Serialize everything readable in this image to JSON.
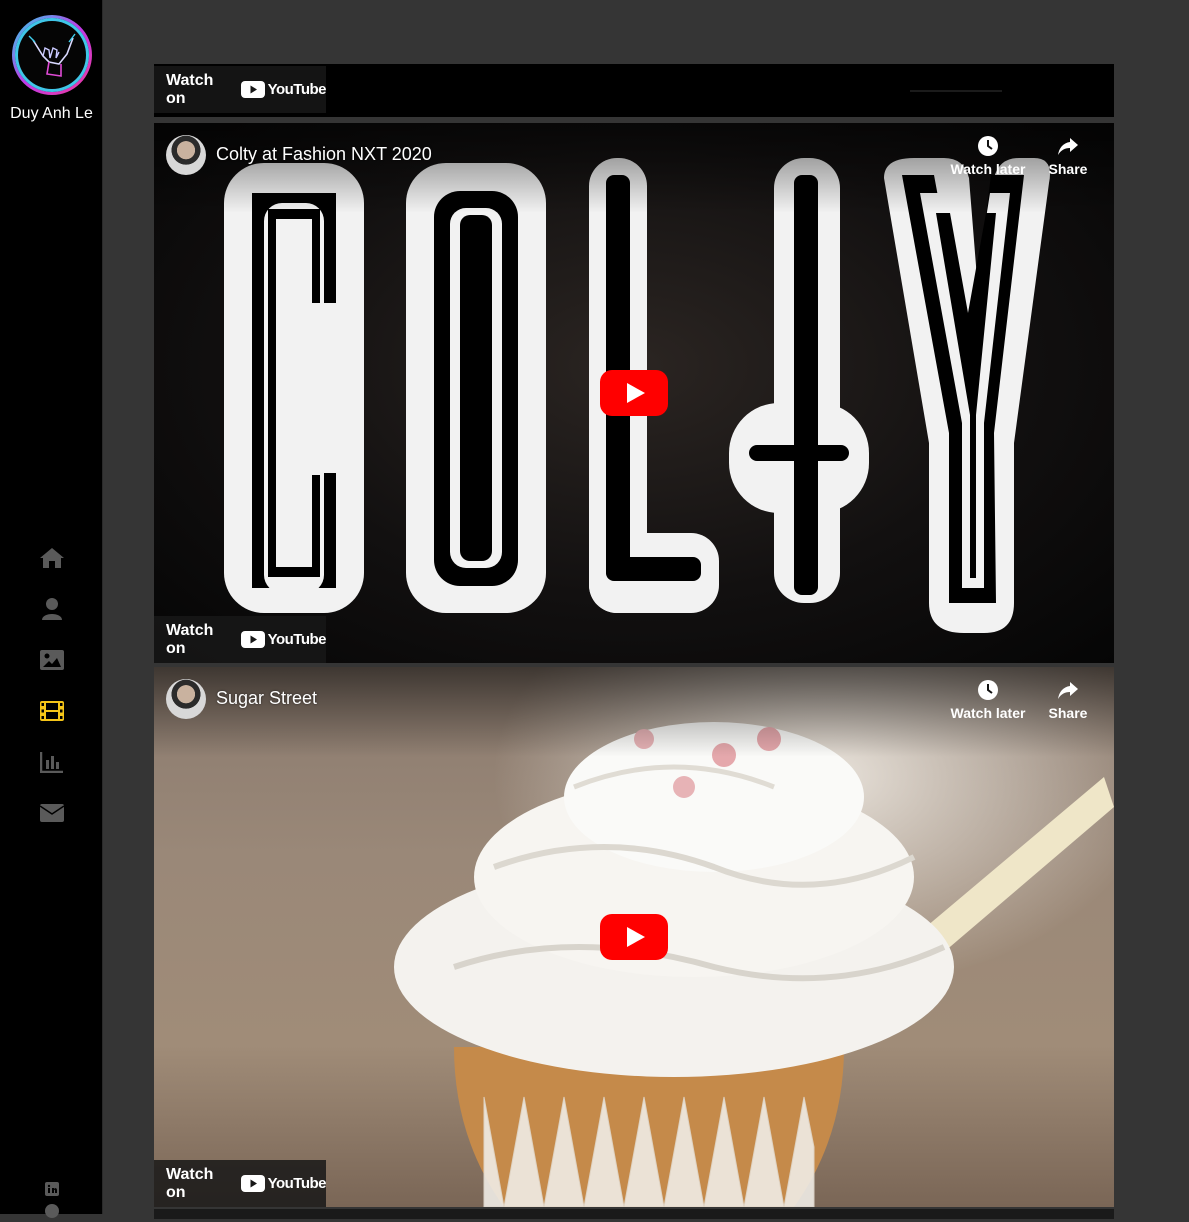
{
  "sidebar": {
    "site_name": "Duy Anh Le",
    "nav": [
      {
        "icon": "home-icon",
        "active": false
      },
      {
        "icon": "user-icon",
        "active": false
      },
      {
        "icon": "image-icon",
        "active": false
      },
      {
        "icon": "film-icon",
        "active": true
      },
      {
        "icon": "chart-icon",
        "active": false
      },
      {
        "icon": "envelope-icon",
        "active": false
      }
    ],
    "social": [
      {
        "icon": "linkedin-icon"
      },
      {
        "icon": "github-icon"
      }
    ],
    "colors": {
      "active": "#f5c518",
      "inactive": "#5a5a5a"
    }
  },
  "videos": [
    {
      "title": "",
      "watch_on": "Watch on",
      "youtube": "YouTube"
    },
    {
      "title": "Colty at Fashion NXT 2020",
      "watch_later": "Watch later",
      "share": "Share",
      "watch_on": "Watch on",
      "youtube": "YouTube",
      "overlay_text": "COLTY"
    },
    {
      "title": "Sugar Street",
      "watch_later": "Watch later",
      "share": "Share",
      "watch_on": "Watch on",
      "youtube": "YouTube"
    }
  ],
  "colors": {
    "youtube_red": "#ff0000",
    "page_bg": "#353535"
  }
}
